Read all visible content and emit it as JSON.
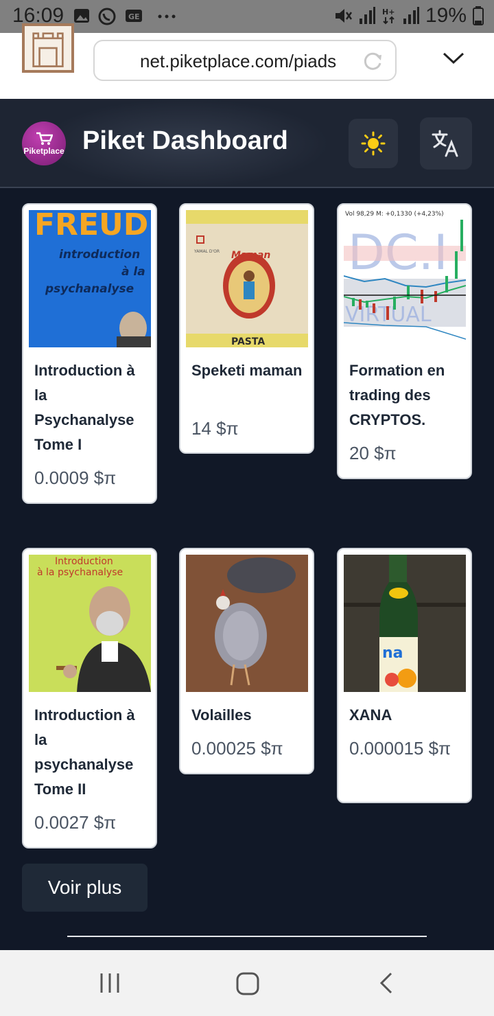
{
  "status_bar": {
    "time": "16:09",
    "battery": "19%",
    "icons": [
      "gallery-icon",
      "whatsapp-icon",
      "ge-icon",
      "more-dots-icon",
      "mute-icon",
      "signal-icon",
      "hplus-icon",
      "battery-icon"
    ]
  },
  "browser": {
    "url": "net.piketplace.com/piads",
    "back_icon": "back-arrow-icon",
    "reload_icon": "reload-icon",
    "menu_icon": "chevron-down-icon"
  },
  "header": {
    "logo_text": "Piketplace",
    "title": "Piket Dashboard",
    "theme_icon": "sun-icon",
    "language_icon": "translate-icon"
  },
  "products": [
    {
      "title": "Introduction à la Psychanalyse Tome I",
      "price": "0.0009 $π",
      "image": "book-cover-freud"
    },
    {
      "title": "Speketi maman",
      "price": "14 $π",
      "image": "pasta-package"
    },
    {
      "title": "Formation en trading des CRYPTOS.",
      "price": "20 $π",
      "image": "trading-chart"
    },
    {
      "title": "Introduction à la psychanalyse Tome II",
      "price": "0.0027 $π",
      "image": "book-cover-freud-2"
    },
    {
      "title": "Volailles",
      "price": "0.00025 $π",
      "image": "guinea-fowl-photo"
    },
    {
      "title": "XANA",
      "price": "0.000015 $π",
      "image": "juice-bottle-photo"
    }
  ],
  "images": {
    "book1_top": "FREUD",
    "book1_lines": [
      "introduction",
      "à la",
      "psychanalyse"
    ],
    "pasta_brand": "Maman",
    "pasta_label": "PASTA",
    "pasta_small": "YAMAL D'OR",
    "trading_top": "Vol 98,29 M: +0,1330 (+4,23%)",
    "trading_watermark": "DC.I",
    "trading_watermark2": "VIRTUAL",
    "book2_lines": [
      "Introduction",
      "à la psychanalyse"
    ]
  },
  "actions": {
    "more_label": "Voir plus"
  },
  "nav": {
    "icons": [
      "recent-apps-icon",
      "home-icon",
      "back-icon"
    ]
  }
}
